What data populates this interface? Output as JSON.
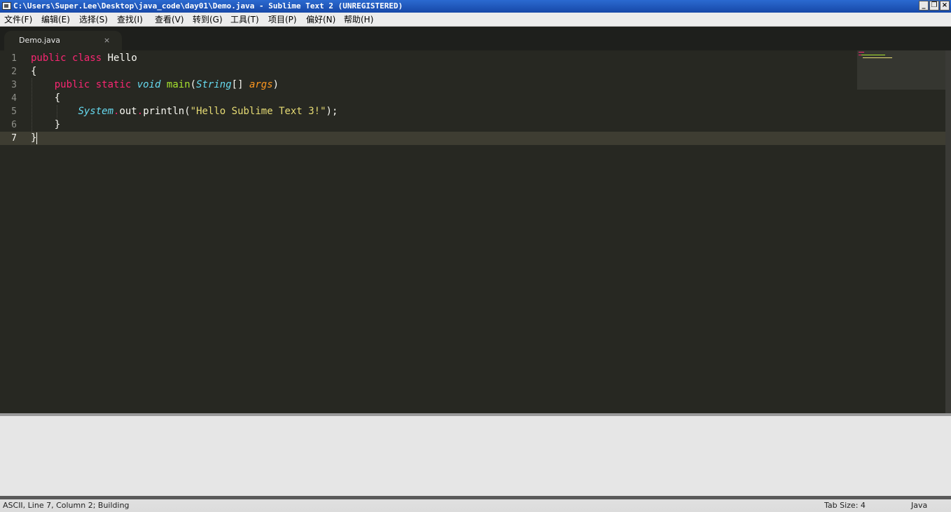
{
  "window": {
    "title": "C:\\Users\\Super.Lee\\Desktop\\java_code\\day01\\Demo.java - Sublime Text 2 (UNREGISTERED)",
    "minimize_label": "_",
    "restore_label": "❐",
    "close_label": "×"
  },
  "menu": {
    "items": [
      {
        "label": "文件(F)"
      },
      {
        "label": "编辑(E)"
      },
      {
        "label": "选择(S)"
      },
      {
        "label": "查找(I)"
      },
      {
        "label": "查看(V)"
      },
      {
        "label": "转到(G)"
      },
      {
        "label": "工具(T)"
      },
      {
        "label": "项目(P)"
      },
      {
        "label": "偏好(N)"
      },
      {
        "label": "帮助(H)"
      }
    ]
  },
  "tabs": [
    {
      "label": "Demo.java",
      "close": "×"
    }
  ],
  "editor": {
    "line_numbers": [
      "1",
      "2",
      "3",
      "4",
      "5",
      "6",
      "7"
    ],
    "current_line": 7,
    "code": {
      "l1": {
        "kw1": "public",
        "kw2": "class",
        "name": "Hello"
      },
      "l2": {
        "brace": "{"
      },
      "l3": {
        "kw1": "public",
        "kw2": "static",
        "type1": "void",
        "fn": "main",
        "paren_open": "(",
        "type2": "String",
        "brackets": "[]",
        "param": "args",
        "paren_close": ")"
      },
      "l4": {
        "brace": "{"
      },
      "l5": {
        "cls": "System",
        "dot1": ".",
        "field": "out",
        "dot2": ".",
        "method": "println",
        "paren_open": "(",
        "string": "\"Hello Sublime Text 3!\"",
        "tail": ");"
      },
      "l6": {
        "brace": "}"
      },
      "l7": {
        "brace": "}"
      }
    }
  },
  "status": {
    "left": "ASCII, Line 7, Column 2; Building",
    "tab_size": "Tab Size: 4",
    "syntax": "Java"
  },
  "colors": {
    "background": "#272822",
    "keyword": "#f92672",
    "type": "#66d9ef",
    "function": "#a6e22e",
    "parameter": "#fd971f",
    "string": "#e6db74"
  }
}
